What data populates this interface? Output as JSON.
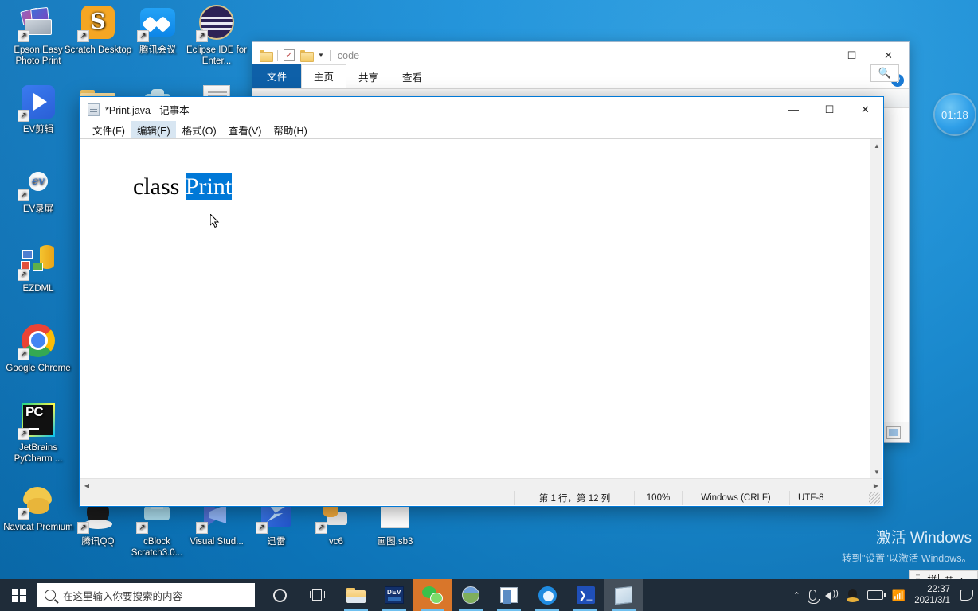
{
  "desktop": {
    "icons": [
      {
        "label": "Epson Easy Photo Print",
        "art": "epson"
      },
      {
        "label": "Scratch Desktop",
        "art": "scratch"
      },
      {
        "label": "腾讯会议",
        "art": "tencentm"
      },
      {
        "label": "Eclipse IDE for Enter...",
        "art": "eclipse"
      },
      {
        "label": "EV剪辑",
        "art": "evcut"
      },
      {
        "label": "EV录屏",
        "art": "evrec"
      },
      {
        "label": "EZDML",
        "art": "ezdml"
      },
      {
        "label": "Google Chrome",
        "art": "chrome"
      },
      {
        "label": "JetBrains PyCharm ...",
        "art": "pycharm"
      },
      {
        "label": "Navicat Premium",
        "art": "navicat"
      },
      {
        "label": "腾讯QQ",
        "art": "qq"
      },
      {
        "label": "cBlock Scratch3.0...",
        "art": "cblock"
      },
      {
        "label": "Visual Stud...",
        "art": "vs"
      },
      {
        "label": "迅雷",
        "art": "xunlei"
      },
      {
        "label": "vc6",
        "art": "vc6"
      },
      {
        "label": "画图.sb3",
        "art": "sb3"
      }
    ]
  },
  "timer": {
    "value": "01:18"
  },
  "watermark": {
    "line1": "激活 Windows",
    "line2": "转到\"设置\"以激活 Windows。"
  },
  "explorer": {
    "path_label": "code",
    "quick_access": [
      "folder-icon",
      "properties-icon",
      "new-folder-icon",
      "customize-caret"
    ],
    "window_buttons": {
      "minimize": "—",
      "maximize": "☐",
      "close": "✕"
    },
    "help": {
      "collapse": "⌃",
      "question": "?"
    },
    "tabs": [
      {
        "label": "文件",
        "state": "file"
      },
      {
        "label": "主页",
        "state": "active"
      },
      {
        "label": "共享",
        "state": "normal"
      },
      {
        "label": "查看",
        "state": "normal"
      }
    ],
    "search_icon": "search-icon"
  },
  "notepad": {
    "title": "*Print.java - 记事本",
    "window_buttons": {
      "minimize": "—",
      "maximize": "☐",
      "close": "✕"
    },
    "menu": [
      {
        "label": "文件(F)",
        "hover": false
      },
      {
        "label": "编辑(E)",
        "hover": true
      },
      {
        "label": "格式(O)",
        "hover": false
      },
      {
        "label": "查看(V)",
        "hover": false
      },
      {
        "label": "帮助(H)",
        "hover": false
      }
    ],
    "editor": {
      "text_plain": "class ",
      "text_selected": "Print"
    },
    "scroll": {
      "up": "▲",
      "down": "▼",
      "left": "◀",
      "right": "▶"
    },
    "status": {
      "position": "第 1 行，第 12 列",
      "zoom": "100%",
      "line_ending": "Windows (CRLF)",
      "encoding": "UTF-8"
    }
  },
  "taskbar": {
    "start": "windows-logo",
    "search_placeholder": "在这里输入你要搜索的内容",
    "buttons": [
      {
        "name": "cortana",
        "art": "cortana",
        "state": "normal"
      },
      {
        "name": "task-view",
        "art": "taskview",
        "state": "normal"
      },
      {
        "name": "file-explorer",
        "art": "explorer",
        "state": "open"
      },
      {
        "name": "dev-cpp",
        "art": "dev",
        "state": "open"
      },
      {
        "name": "wechat",
        "art": "wechat",
        "state": "active"
      },
      {
        "name": "photos",
        "art": "photo",
        "state": "open"
      },
      {
        "name": "app-window",
        "art": "app2",
        "state": "open"
      },
      {
        "name": "quark-browser",
        "art": "quark",
        "state": "open"
      },
      {
        "name": "powershell",
        "art": "ps",
        "state": "open"
      },
      {
        "name": "notepad",
        "art": "notepad",
        "state": "lightsel"
      }
    ],
    "tray": {
      "show_hidden": "⌃",
      "microphone": "mic-icon",
      "volume": "speaker-icon",
      "qq": "qq-icon",
      "battery": "battery-icon",
      "network": "wifi-icon",
      "time": "22:37",
      "date": "2021/3/1",
      "action_center": "notification-icon"
    }
  },
  "ime": {
    "handle": "drag-handle",
    "mode": "拼",
    "language": "英",
    "moon": "♪",
    "dot": "●"
  }
}
